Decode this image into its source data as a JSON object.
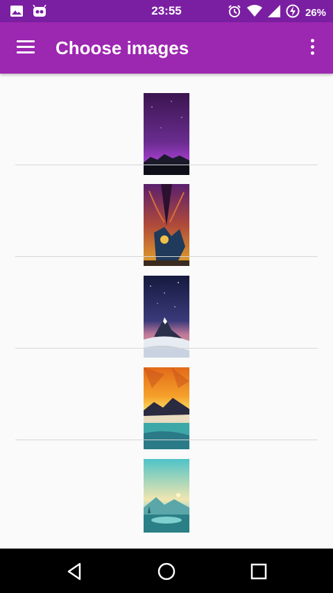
{
  "status_bar": {
    "time": "23:55",
    "battery_percent": "26%",
    "icons_left": [
      "image-icon",
      "android-robot-icon"
    ],
    "icons_right": [
      "alarm-icon",
      "wifi-icon",
      "cell-signal-icon",
      "battery-charging-icon"
    ]
  },
  "app_bar": {
    "title": "Choose images",
    "menu_icon": "menu-icon",
    "overflow_icon": "more-vert-icon",
    "color": "#9c27b0",
    "status_color": "#7b1fa2"
  },
  "images": [
    {
      "name": "purple-night-mountains"
    },
    {
      "name": "psychedelic-forest-figures"
    },
    {
      "name": "matterhorn-starry-night"
    },
    {
      "name": "sunset-low-poly-lake"
    },
    {
      "name": "teal-lake-morning"
    }
  ],
  "nav_bar": {
    "back_icon": "back-triangle-icon",
    "home_icon": "home-circle-icon",
    "recents_icon": "recents-square-icon"
  }
}
